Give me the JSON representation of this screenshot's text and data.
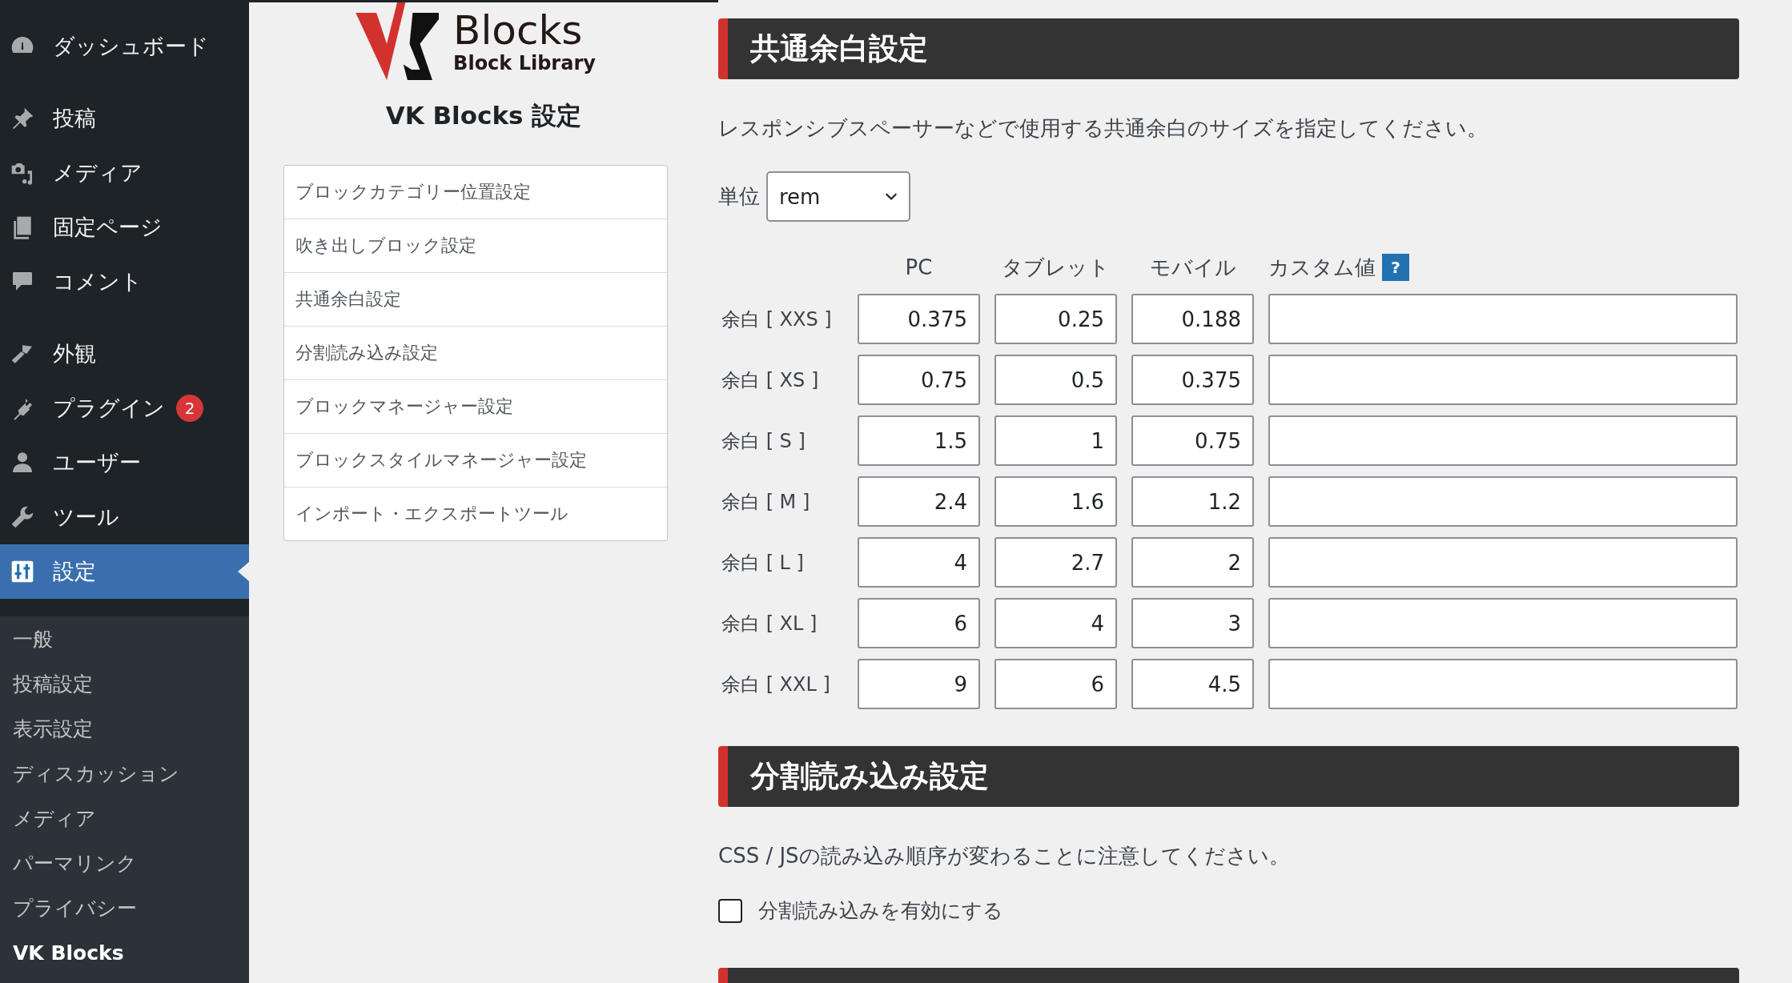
{
  "sidebar": {
    "menu_groups": [
      [
        {
          "label": "ダッシュボード",
          "selected": false
        }
      ],
      [
        {
          "label": "投稿",
          "selected": false
        },
        {
          "label": "メディア",
          "selected": false
        },
        {
          "label": "固定ページ",
          "selected": false
        },
        {
          "label": "コメント",
          "selected": false
        }
      ],
      [
        {
          "label": "外観",
          "selected": false
        },
        {
          "label": "プラグイン",
          "selected": false,
          "badge": "2"
        },
        {
          "label": "ユーザー",
          "selected": false
        },
        {
          "label": "ツール",
          "selected": false
        },
        {
          "label": "設定",
          "selected": true
        }
      ]
    ],
    "submenu": [
      {
        "label": "一般",
        "selected": false
      },
      {
        "label": "投稿設定",
        "selected": false
      },
      {
        "label": "表示設定",
        "selected": false
      },
      {
        "label": "ディスカッション",
        "selected": false
      },
      {
        "label": "メディア",
        "selected": false
      },
      {
        "label": "パーマリンク",
        "selected": false
      },
      {
        "label": "プライバシー",
        "selected": false
      },
      {
        "label": "VK Blocks",
        "selected": true
      }
    ]
  },
  "logo": {
    "title": "Blocks",
    "subtitle": "Block Library"
  },
  "page_title": "VK Blocks 設定",
  "nav": [
    "ブロックカテゴリー位置設定",
    "吹き出しブロック設定",
    "共通余白設定",
    "分割読み込み設定",
    "ブロックマネージャー設定",
    "ブロックスタイルマネージャー設定",
    "インポート・エクスポートツール"
  ],
  "sections": [
    {
      "kind": "spacing",
      "title": "共通余白設定",
      "description": "レスポンシブスペーサーなどで使用する共通余白のサイズを指定してください。",
      "unit": {
        "label": "単位",
        "value": "rem"
      },
      "columns": [
        "PC",
        "タブレット",
        "モバイル",
        "カスタム値"
      ],
      "help": "?",
      "rows": [
        {
          "label": "余白 [ XXS ]",
          "values": [
            "0.375",
            "0.25",
            "0.188"
          ]
        },
        {
          "label": "余白 [ XS ]",
          "values": [
            "0.75",
            "0.5",
            "0.375"
          ]
        },
        {
          "label": "余白 [ S ]",
          "values": [
            "1.5",
            "1",
            "0.75"
          ]
        },
        {
          "label": "余白 [ M ]",
          "values": [
            "2.4",
            "1.6",
            "1.2"
          ]
        },
        {
          "label": "余白 [ L ]",
          "values": [
            "4",
            "2.7",
            "2"
          ]
        },
        {
          "label": "余白 [ XL ]",
          "values": [
            "6",
            "4",
            "3"
          ]
        },
        {
          "label": "余白 [ XXL ]",
          "values": [
            "9",
            "6",
            "4.5"
          ]
        }
      ]
    },
    {
      "kind": "checkbox",
      "title": "分割読み込み設定",
      "description": "CSS / JSの読み込み順序が変わることに注意してください。",
      "option": {
        "label": "分割読み込みを有効にする",
        "checked": false
      }
    }
  ]
}
